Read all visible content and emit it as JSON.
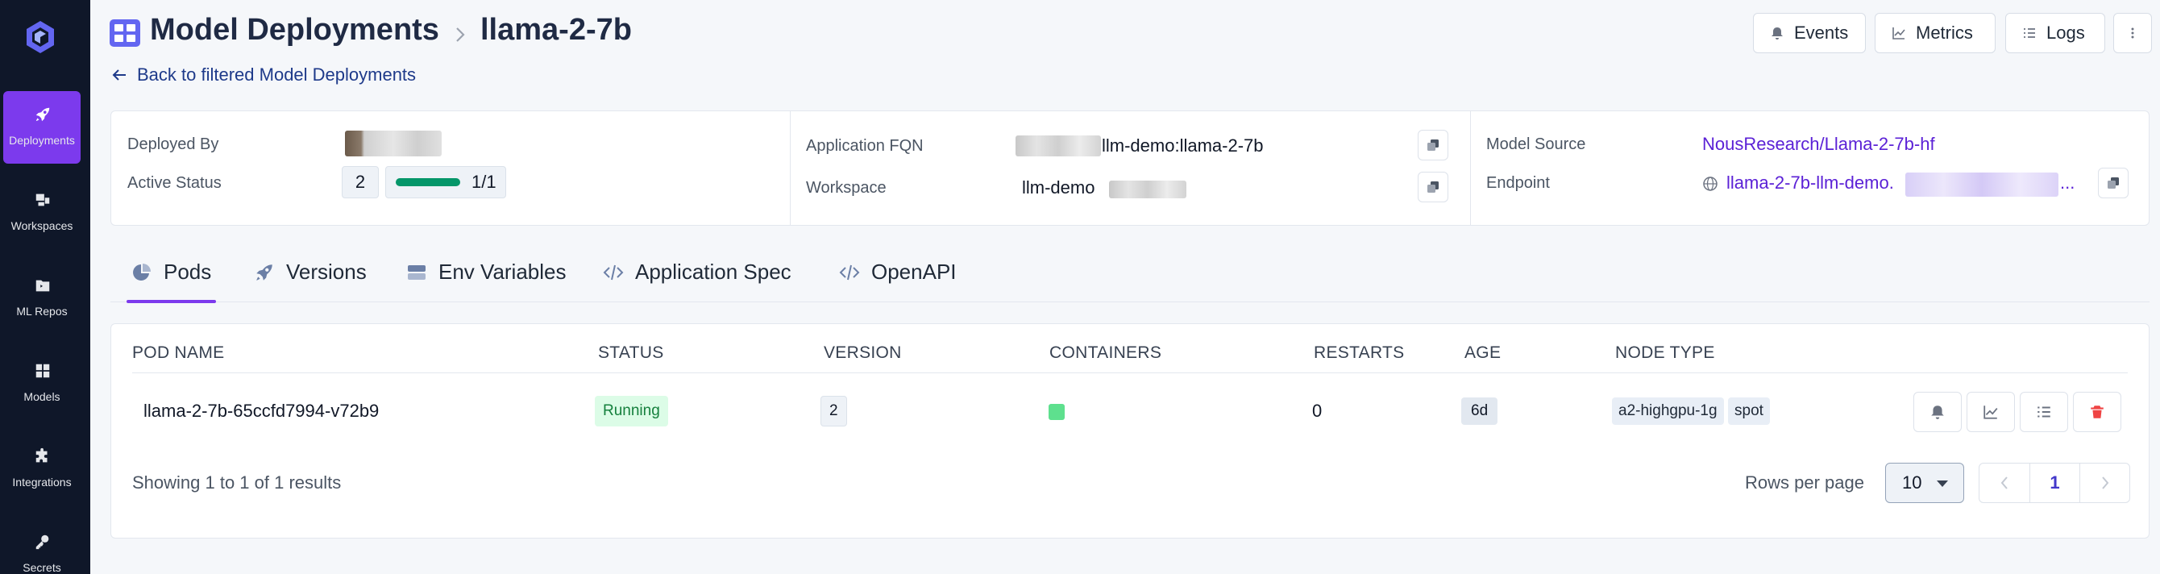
{
  "sidebar": {
    "items": [
      {
        "label": "Deployments",
        "icon": "rocket-icon",
        "active": true
      },
      {
        "label": "Workspaces",
        "icon": "workspaces-icon",
        "active": false
      },
      {
        "label": "ML Repos",
        "icon": "folder-icon",
        "active": false
      },
      {
        "label": "Models",
        "icon": "grid-icon",
        "active": false
      },
      {
        "label": "Integrations",
        "icon": "puzzle-icon",
        "active": false
      },
      {
        "label": "Secrets",
        "icon": "key-icon",
        "active": false
      }
    ]
  },
  "header": {
    "title": "Model Deployments",
    "subtitle": "llama-2-7b",
    "back_link": "Back to filtered Model Deployments",
    "buttons": {
      "events": "Events",
      "metrics": "Metrics",
      "logs": "Logs"
    }
  },
  "info": {
    "deployed_by_label": "Deployed By",
    "active_status_label": "Active Status",
    "active_status_version": "2",
    "active_status_ratio": "1/1",
    "active_status_fraction": 1.0,
    "application_fqn_label": "Application FQN",
    "application_fqn_value": "llm-demo:llama-2-7b",
    "workspace_label": "Workspace",
    "workspace_value": "llm-demo",
    "model_source_label": "Model Source",
    "model_source_value": "NousResearch/Llama-2-7b-hf",
    "endpoint_label": "Endpoint",
    "endpoint_value": "llama-2-7b-llm-demo.",
    "endpoint_ellipsis": "..."
  },
  "tabs": [
    {
      "label": "Pods",
      "icon": "pie-chart-icon",
      "active": true
    },
    {
      "label": "Versions",
      "icon": "rocket-icon",
      "active": false
    },
    {
      "label": "Env Variables",
      "icon": "server-icon",
      "active": false
    },
    {
      "label": "Application Spec",
      "icon": "code-icon",
      "active": false
    },
    {
      "label": "OpenAPI",
      "icon": "code-icon",
      "active": false
    }
  ],
  "table": {
    "columns": [
      "POD NAME",
      "STATUS",
      "VERSION",
      "CONTAINERS",
      "RESTARTS",
      "AGE",
      "NODE TYPE"
    ],
    "rows": [
      {
        "pod_name": "llama-2-7b-65ccfd7994-v72b9",
        "status": "Running",
        "version": "2",
        "restarts": "0",
        "age": "6d",
        "node_types": [
          "a2-highgpu-1g",
          "spot"
        ]
      }
    ],
    "footer": "Showing 1 to 1 of 1 results",
    "rows_per_page_label": "Rows per page",
    "rows_per_page_value": "10",
    "current_page": "1"
  },
  "colors": {
    "accent": "#7c3aed",
    "sidebar_bg": "#0f1729",
    "link": "#5b21d6",
    "success": "#15803d",
    "danger": "#ef4444"
  }
}
